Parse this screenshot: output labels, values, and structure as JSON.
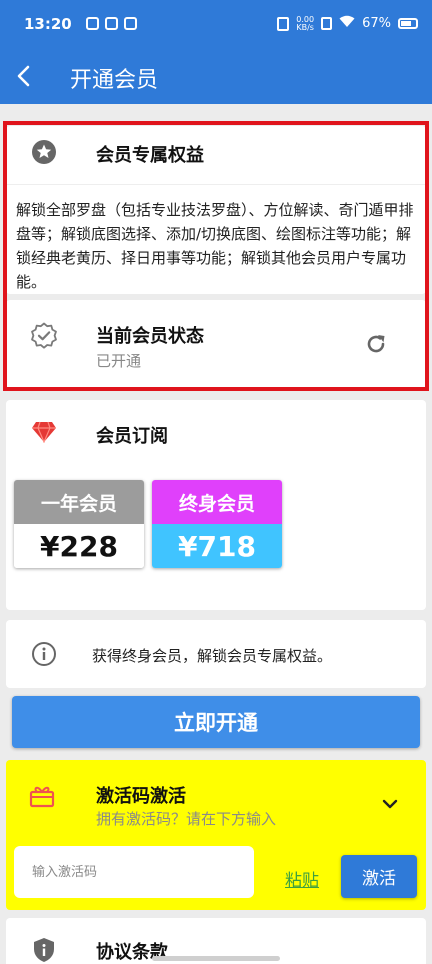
{
  "status": {
    "time": "13:20",
    "speed_value": "0.00",
    "speed_unit": "KB/s",
    "battery": "67%"
  },
  "appbar": {
    "back": "‹",
    "title": "开通会员"
  },
  "benefits": {
    "title": "会员专属权益",
    "description": "解锁全部罗盘（包括专业技法罗盘）、方位解读、奇门遁甲排盘等；解锁底图选择、添加/切换底图、绘图标注等功能；解锁经典老黄历、择日用事等功能；解锁其他会员用户专属功能。"
  },
  "status_card": {
    "title": "当前会员状态",
    "subtitle": "已开通"
  },
  "subscription": {
    "title": "会员订阅",
    "plans": [
      {
        "name": "一年会员",
        "price": "¥228"
      },
      {
        "name": "终身会员",
        "price": "¥718"
      }
    ]
  },
  "info": {
    "text": "获得终身会员，解锁会员专属权益。"
  },
  "open_button": "立即开通",
  "activation": {
    "title": "激活码激活",
    "subtitle": "拥有激活码？请在下方输入",
    "placeholder": "输入激活码",
    "paste": "粘贴",
    "submit": "激活"
  },
  "agreement": {
    "title": "协议条款"
  },
  "colors": {
    "primary": "#2f7ad8",
    "button": "#3f8ee8",
    "highlight_border": "#e0141c",
    "plan_year_header": "#9c9c9c",
    "plan_lifetime_header": "#e040fb",
    "plan_lifetime_body": "#40c4ff",
    "activation_bg": "#ffff00",
    "paste_link": "#3fa13f",
    "diamond": "#e53935",
    "gift": "#ef5350"
  },
  "icons": {
    "back": "arrow-left-icon",
    "benefits": "star-badge-icon",
    "status": "verified-badge-icon",
    "refresh": "refresh-icon",
    "subscription": "diamond-icon",
    "info": "info-icon",
    "activation": "gift-icon",
    "expand": "chevron-down-icon",
    "agreement": "shield-info-icon"
  }
}
